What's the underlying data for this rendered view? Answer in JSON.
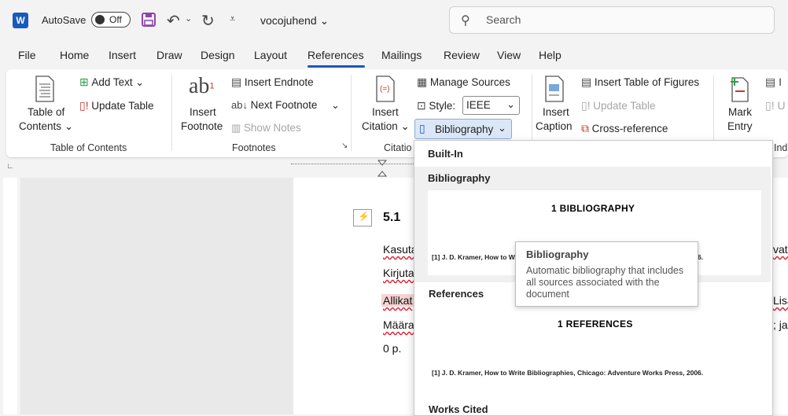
{
  "titlebar": {
    "app_logo": "W",
    "autosave_label": "AutoSave",
    "autosave_state": "Off",
    "doc_title": "vocojuhend",
    "search_placeholder": "Search"
  },
  "tabs": [
    "File",
    "Home",
    "Insert",
    "Draw",
    "Design",
    "Layout",
    "References",
    "Mailings",
    "Review",
    "View",
    "Help"
  ],
  "active_tab": "References",
  "ribbon": {
    "toc": {
      "big_label_1": "Table of",
      "big_label_2": "Contents",
      "add_text": "Add Text",
      "update_table": "Update Table",
      "group": "Table of Contents"
    },
    "footnotes": {
      "big_label_1": "Insert",
      "big_label_2": "Footnote",
      "insert_endnote": "Insert Endnote",
      "next_footnote": "Next Footnote",
      "show_notes": "Show Notes",
      "group": "Footnotes",
      "ab_glyph": "ab",
      "sup": "1"
    },
    "citations": {
      "big_label_1": "Insert",
      "big_label_2": "Citation",
      "manage_sources": "Manage Sources",
      "style_label": "Style:",
      "style_value": "IEEE",
      "bibliography": "Bibliography",
      "group": "Citatio"
    },
    "captions": {
      "big_label_1": "Insert",
      "big_label_2": "Caption",
      "insert_tof": "Insert Table of Figures",
      "update_table": "Update Table",
      "cross_reference": "Cross-reference"
    },
    "index": {
      "big_label_1": "Mark",
      "big_label_2": "Entry",
      "group": "Ind"
    }
  },
  "document": {
    "heading": "5.1",
    "lines": [
      "Kasuta",
      "Kirjuta",
      "Allikat",
      "Määra",
      "0 p."
    ],
    "right_fragments": [
      "vate",
      "Lisa",
      "; ja"
    ]
  },
  "gallery": {
    "section_builtin": "Built-In",
    "items": [
      {
        "name": "Bibliography",
        "thumb_title": "1   BIBLIOGRAPHY",
        "thumb_ref": "[1]  J. D. Kramer, How to Write Bibliographies, Chicago: Adventure Works Press, 2006."
      },
      {
        "name": "References",
        "thumb_title": "1   REFERENCES",
        "thumb_ref": "[1]  J. D. Kramer, How to Write Bibliographies, Chicago: Adventure Works Press, 2006."
      },
      {
        "name": "Works Cited"
      }
    ]
  },
  "tooltip": {
    "title": "Bibliography",
    "body": "Automatic bibliography that includes all sources associated with the document"
  },
  "colors": {
    "accent": "#185abd",
    "save_icon": "#8e44ad",
    "footnote_red": "#c0392b",
    "mark_entry_green": "#2e9e44"
  }
}
